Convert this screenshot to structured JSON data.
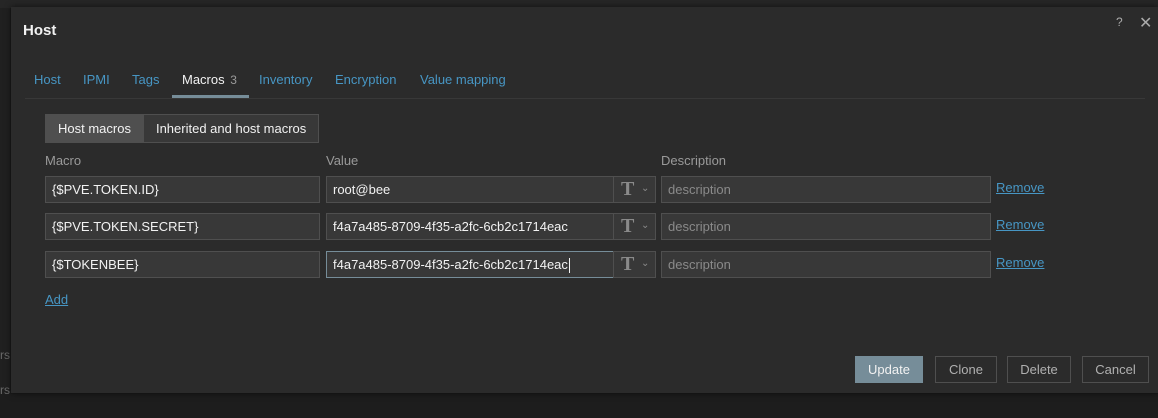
{
  "background": {
    "ghost_text_1": "rs",
    "ghost_text_2": "rs"
  },
  "dialog": {
    "title": "Host",
    "help": "?",
    "close": "✕"
  },
  "tabs": [
    {
      "label": "Host"
    },
    {
      "label": "IPMI"
    },
    {
      "label": "Tags"
    },
    {
      "label": "Macros",
      "count": "3",
      "active": true
    },
    {
      "label": "Inventory"
    },
    {
      "label": "Encryption"
    },
    {
      "label": "Value mapping"
    }
  ],
  "segmented": {
    "host_macros": "Host macros",
    "inherited_macros": "Inherited and host macros",
    "selected": "Host macros"
  },
  "columns": {
    "macro": "Macro",
    "value": "Value",
    "description": "Description"
  },
  "macros": [
    {
      "macro": "{$PVE.TOKEN.ID}",
      "value": "root@bee",
      "type_icon": "T",
      "description_placeholder": "description",
      "remove": "Remove"
    },
    {
      "macro": "{$PVE.TOKEN.SECRET}",
      "value": "f4a7a485-8709-4f35-a2fc-6cb2c1714eac",
      "type_icon": "T",
      "description_placeholder": "description",
      "remove": "Remove"
    },
    {
      "macro": "{$TOKENBEE}",
      "value": "f4a7a485-8709-4f35-a2fc-6cb2c1714eac",
      "type_icon": "T",
      "description_placeholder": "description",
      "remove": "Remove"
    }
  ],
  "add_label": "Add",
  "buttons": {
    "update": "Update",
    "clone": "Clone",
    "delete": "Delete",
    "cancel": "Cancel"
  },
  "colors": {
    "accent": "#768d99",
    "link": "#4796c4",
    "dialog_bg": "#2b2b2b",
    "input_bg": "#383838"
  }
}
